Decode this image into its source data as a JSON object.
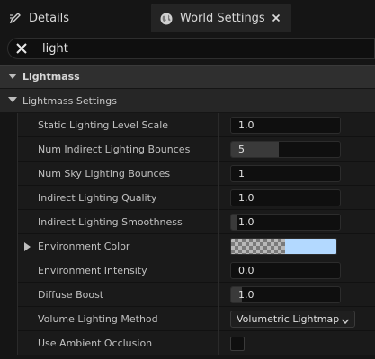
{
  "tabs": [
    {
      "label": "Details",
      "icon": "pencil-icon"
    },
    {
      "label": "World Settings",
      "icon": "globe-icon",
      "active": true
    }
  ],
  "search": {
    "value": "light"
  },
  "categories": {
    "lightmass": "Lightmass",
    "lightmass_settings": "Lightmass Settings"
  },
  "properties": {
    "static_lighting_level_scale": {
      "label": "Static Lighting Level Scale",
      "value": "1.0"
    },
    "num_indirect_lighting_bounces": {
      "label": "Num Indirect Lighting Bounces",
      "value": "5"
    },
    "num_sky_lighting_bounces": {
      "label": "Num Sky Lighting Bounces",
      "value": "1"
    },
    "indirect_lighting_quality": {
      "label": "Indirect Lighting Quality",
      "value": "1.0"
    },
    "indirect_lighting_smoothness": {
      "label": "Indirect Lighting Smoothness",
      "value": "1.0"
    },
    "environment_color": {
      "label": "Environment Color",
      "color": "#b3d9ff"
    },
    "environment_intensity": {
      "label": "Environment Intensity",
      "value": "0.0"
    },
    "diffuse_boost": {
      "label": "Diffuse Boost",
      "value": "1.0"
    },
    "volume_lighting_method": {
      "label": "Volume Lighting Method",
      "value": "Volumetric Lightmap"
    },
    "use_ambient_occlusion": {
      "label": "Use Ambient Occlusion",
      "checked": false
    }
  },
  "colors": {
    "background": "#151515",
    "row": "#1a1a1a",
    "accent_text": "#e0e0e0"
  }
}
